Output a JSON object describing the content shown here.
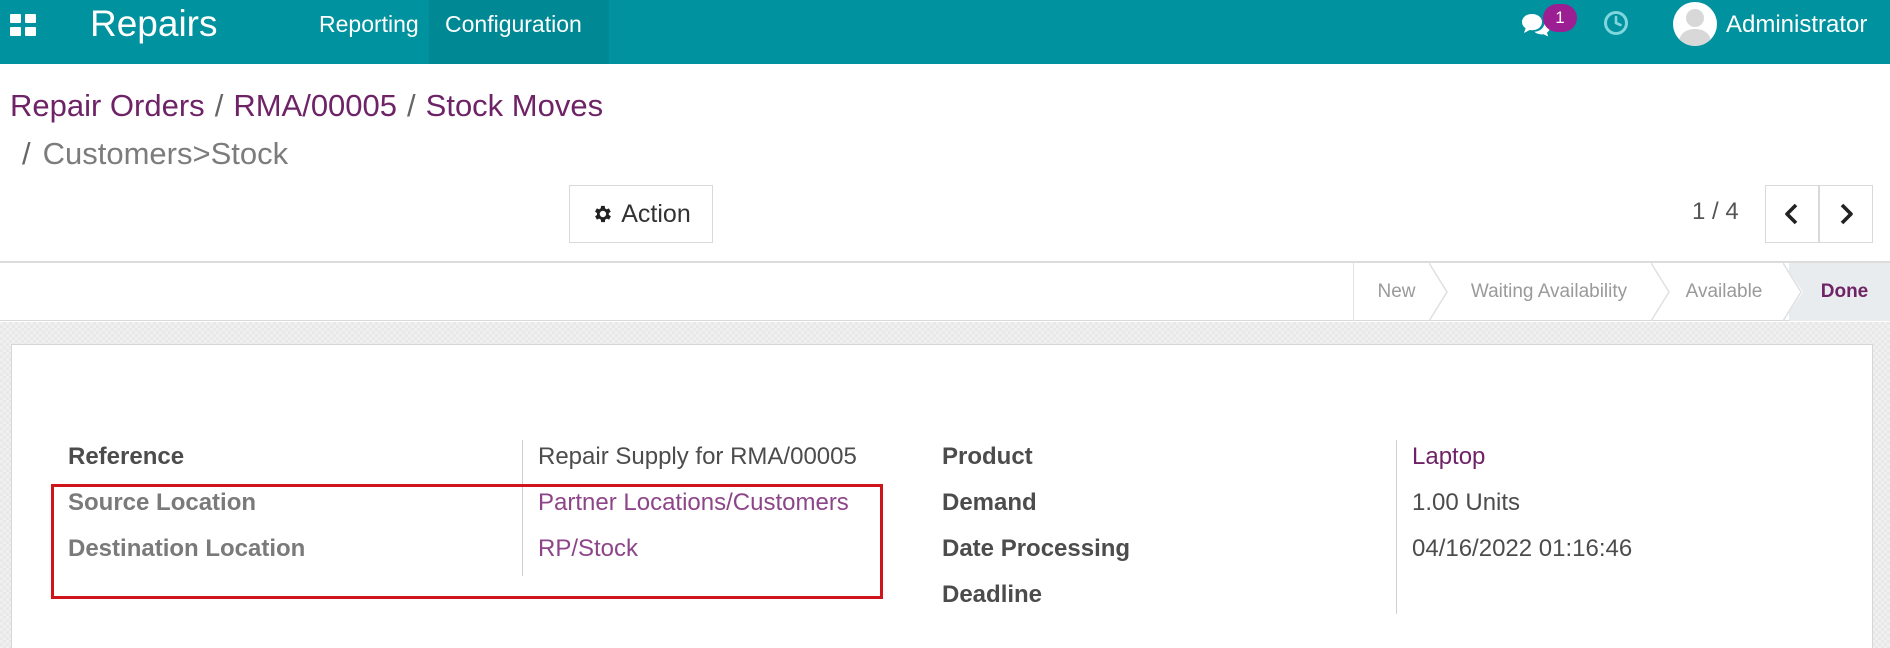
{
  "navbar": {
    "app_name": "Repairs",
    "menu": [
      "Reporting",
      "Configuration"
    ],
    "messages_badge": "1",
    "user_name": "Administrator",
    "icons": [
      "apps-grid-icon",
      "chat-icon",
      "clock-icon",
      "user-avatar-icon"
    ]
  },
  "breadcrumb": {
    "items": [
      "Repair Orders",
      "RMA/00005",
      "Stock Moves"
    ],
    "current": "Customers>Stock",
    "separator": "/"
  },
  "toolbar": {
    "action_label": "Action",
    "pager": "1 / 4"
  },
  "statusbar": {
    "stages": [
      "New",
      "Waiting Availability",
      "Available",
      "Done"
    ],
    "active": "Done"
  },
  "form": {
    "left": [
      {
        "label": "Reference",
        "value": "Repair Supply for RMA/00005"
      },
      {
        "label": "Source Location",
        "value": "Partner Locations/Customers"
      },
      {
        "label": "Destination Location",
        "value": "RP/Stock"
      }
    ],
    "right": [
      {
        "label": "Product",
        "value": "Laptop"
      },
      {
        "label": "Demand",
        "value": "1.00 Units"
      },
      {
        "label": "Date Processing",
        "value": "04/16/2022 01:16:46"
      },
      {
        "label": "Deadline",
        "value": ""
      }
    ]
  },
  "colors": {
    "navbar": "#00929e",
    "link": "#6f2367",
    "badge": "#9b1f92",
    "highlight": "#d0141c"
  }
}
